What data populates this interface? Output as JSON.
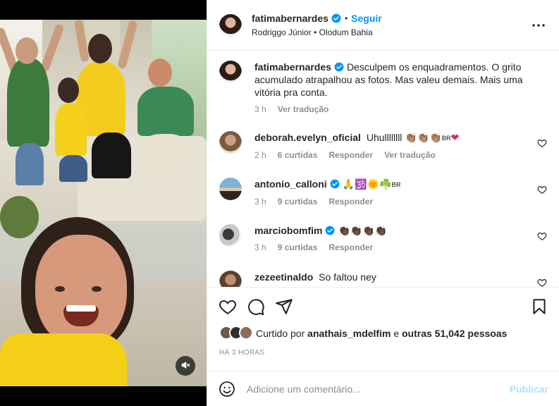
{
  "post": {
    "username": "fatimabernardes",
    "follow_label": "Seguir",
    "separator": "•",
    "audio": "Rodriggo Júnior • Olodum Bahia",
    "caption": {
      "username": "fatimabernardes",
      "text": "Desculpem os enquadramentos. O grito acumulado atrapalhou as fotos. Mas valeu demais. Mais uma vitória pra conta.",
      "time": "3 h",
      "translate": "Ver tradução"
    }
  },
  "comments": [
    {
      "user": "deborah.evelyn_oficial",
      "text": "Uhullllllll",
      "emojis": "👏🏽👏🏽👏🏽",
      "flag": "BR",
      "extra": "❤",
      "time": "2 h",
      "likes": "6 curtidas",
      "reply": "Responder",
      "translate": "Ver tradução"
    },
    {
      "user": "antonio_calloni",
      "text": "",
      "emojis": "🙏🕉️🌞☘️",
      "flag": "BR",
      "extra": "",
      "time": "3 h",
      "likes": "9 curtidas",
      "reply": "Responder",
      "translate": ""
    },
    {
      "user": "marciobomfim",
      "text": "",
      "emojis": "👏🏿👏🏿👏🏿👏🏿",
      "flag": "",
      "extra": "",
      "time": "3 h",
      "likes": "9 curtidas",
      "reply": "Responder",
      "translate": ""
    },
    {
      "user": "zezeetinaldo",
      "text": "So faltou ney",
      "emojis": "",
      "flag": "",
      "extra": "",
      "time": "",
      "likes": "",
      "reply": "",
      "translate": ""
    }
  ],
  "likes": {
    "prefix": "Curtido por",
    "user": "anathais_mdelfim",
    "middle": "e",
    "others": "outras 51,042 pessoas"
  },
  "timestamp": "HÁ 3 HORAS",
  "add_comment": {
    "placeholder": "Adicione um comentário...",
    "publish": "Publicar"
  },
  "icons": {
    "verified": "verified-badge-icon",
    "more": "more-options-icon",
    "like": "heart-icon",
    "comment": "comment-bubble-icon",
    "share": "send-paper-plane-icon",
    "save": "bookmark-icon",
    "emoji": "smiley-icon",
    "mute": "speaker-muted-icon"
  },
  "colors": {
    "accent": "#0095f6",
    "publish_disabled": "#b2dffc",
    "secondary_text": "#8e8e8e"
  }
}
